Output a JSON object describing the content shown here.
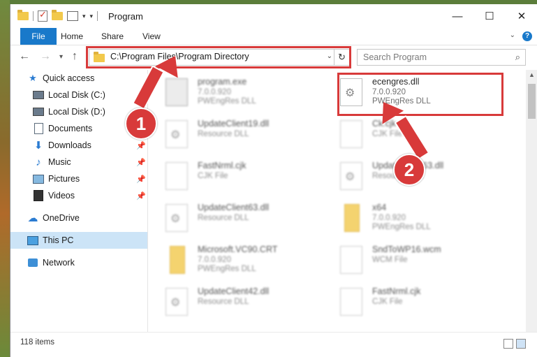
{
  "window": {
    "title": "Program",
    "controls": {
      "minimize": "—",
      "maximize": "☐",
      "close": "✕"
    }
  },
  "ribbon": {
    "tabs": [
      "File",
      "Home",
      "Share",
      "View"
    ]
  },
  "nav": {
    "back": "←",
    "forward": "→",
    "recent": "▾",
    "up": "↑",
    "address": "C:\\Program Files\\Program Directory",
    "search_placeholder": "Search Program"
  },
  "sidebar": {
    "items": [
      {
        "label": "Quick access",
        "pinned": false
      },
      {
        "label": "Local Disk (C:)",
        "pinned": true
      },
      {
        "label": "Local Disk (D:)",
        "pinned": false
      },
      {
        "label": "Documents",
        "pinned": true
      },
      {
        "label": "Downloads",
        "pinned": true
      },
      {
        "label": "Music",
        "pinned": true
      },
      {
        "label": "Pictures",
        "pinned": true
      },
      {
        "label": "Videos",
        "pinned": true
      },
      {
        "label": "OneDrive",
        "pinned": false
      },
      {
        "label": "This PC",
        "pinned": false,
        "selected": true
      },
      {
        "label": "Network",
        "pinned": false
      }
    ]
  },
  "files": [
    {
      "name": "program.exe",
      "line1": "7.0.0.920",
      "line2": "PWEngRes DLL",
      "icon": "exe-icon"
    },
    {
      "name": "ecengres.dll",
      "line1": "7.0.0.920",
      "line2": "PWEngRes DLL",
      "icon": "dll-gear-icon",
      "highlighted": true
    },
    {
      "name": "UpdateClient19.dll",
      "line1": "Resource DLL",
      "line2": "",
      "icon": "dll-gear-icon"
    },
    {
      "name": "Ck.cjk",
      "line1": "CJK File",
      "line2": "",
      "icon": "file-icon"
    },
    {
      "name": "FastNrml.cjk",
      "line1": "CJK File",
      "line2": "",
      "icon": "file-icon"
    },
    {
      "name": "UpdateClient63.dll",
      "line1": "Resource DLL",
      "line2": "",
      "icon": "dll-gear-icon"
    },
    {
      "name": "UpdateClient63.dll",
      "line1": "Resource DLL",
      "line2": "",
      "icon": "dll-gear-icon"
    },
    {
      "name": "x64",
      "line1": "7.0.0.920",
      "line2": "PWEngRes DLL",
      "icon": "folder-icon"
    },
    {
      "name": "Microsoft.VC90.CRT",
      "line1": "7.0.0.920",
      "line2": "PWEngRes DLL",
      "icon": "folder-icon"
    },
    {
      "name": "SndToWP16.wcm",
      "line1": "WCM File",
      "line2": "",
      "icon": "file-icon"
    },
    {
      "name": "UpdateClient42.dll",
      "line1": "Resource DLL",
      "line2": "",
      "icon": "dll-gear-icon"
    },
    {
      "name": "FastNrml.cjk",
      "line1": "CJK File",
      "line2": "",
      "icon": "file-icon"
    }
  ],
  "status": {
    "item_count": "118 items"
  },
  "callouts": [
    "1",
    "2"
  ],
  "colors": {
    "accent": "#1979ca",
    "highlight": "#d83a3a",
    "selection": "#cce4f7"
  }
}
